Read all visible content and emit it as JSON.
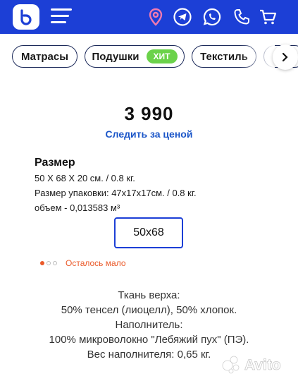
{
  "header": {
    "icons": [
      "logo-icon",
      "menu-icon",
      "location-icon",
      "telegram-icon",
      "whatsapp-icon",
      "phone-icon",
      "cart-icon"
    ],
    "brand_color": "#1c3fd6"
  },
  "categories": [
    {
      "label": "Матрасы"
    },
    {
      "label": "Подушки",
      "badge": "ХИТ"
    },
    {
      "label": "Текстиль"
    },
    {
      "label": ""
    }
  ],
  "product": {
    "price": "3 990",
    "follow_price": "Следить за ценой",
    "size_title": "Размер",
    "specs": [
      "50 Х 68 Х 20 см. / 0.8 кг.",
      "Размер упаковки: 47x17x17см. / 0.8 кг.",
      "объем - 0,013583 м³"
    ],
    "selected_size": "50x68",
    "stock_label": "Осталось мало",
    "stock_level": "1 of 3"
  },
  "description": [
    "Ткань верха:",
    "50% тенсел (лиоцелл), 50% хлопок.",
    "Наполнитель:",
    "100% микроволокно \"Лебяжий пух\" (ПЭ).",
    "Вес наполнителя: 0,65 кг."
  ],
  "watermark": {
    "text": "Avito"
  },
  "colors": {
    "accent": "#1c3fd6",
    "link": "#1a55c8",
    "warning": "#ea5a2a",
    "badge": "#6bd24a"
  }
}
